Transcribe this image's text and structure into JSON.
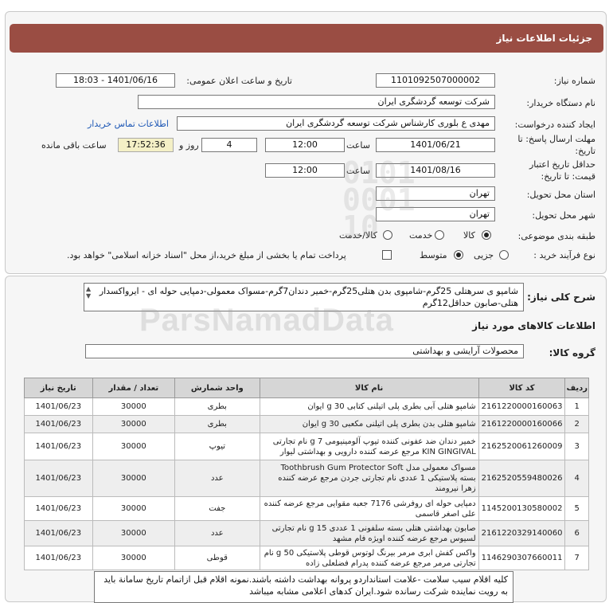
{
  "header": {
    "title": "جزئیات اطلاعات نیاز"
  },
  "form": {
    "need_number_label": "شماره نیاز:",
    "need_number": "1101092507000002",
    "announce_label": "تاریخ و ساعت اعلان عمومی:",
    "announce_value": "1401/06/16 - 18:03",
    "buyer_label": "نام دستگاه خریدار:",
    "buyer_value": "شرکت توسعه گردشگری ایران",
    "creator_label": "ایجاد کننده درخواست:",
    "creator_value": "مهدی ع بلوری کارشناس شرکت توسعه گردشگری ایران",
    "contact_link": "اطلاعات تماس خریدار",
    "deadline_label_1": "مهلت ارسال پاسخ: تا",
    "deadline_label_2": "تاریخ:",
    "deadline_date": "1401/06/21",
    "time_label": "ساعت",
    "deadline_time": "12:00",
    "days_value": "4",
    "days_label": "روز و",
    "remaining_time": "17:52:36",
    "remaining_label": "ساعت باقی مانده",
    "validity_label_1": "حداقل تاریخ اعتبار",
    "validity_label_2": "قیمت: تا تاریخ:",
    "validity_date": "1401/08/16",
    "validity_time": "12:00",
    "province_label": "استان محل تحویل:",
    "province_value": "تهران",
    "city_label": "شهر محل تحویل:",
    "city_value": "تهران",
    "category_label": "طبقه بندی موضوعی:",
    "category_options": [
      "کالا",
      "خدمت",
      "کالا/خدمت"
    ],
    "category_selected": "کالا",
    "process_label": "نوع فرآیند خرید :",
    "process_options": [
      "جزیی",
      "متوسط"
    ],
    "process_selected": "متوسط",
    "payment_text": "پرداخت تمام یا بخشی از مبلغ خرید،از محل \"اسناد خزانه اسلامی\" خواهد بود."
  },
  "description": {
    "label": "شرح کلی نیاز:",
    "text": "شامپو ی سرهتلی 25گرم-شامپوی بدن هتلی25گرم-خمیر دندان7گرم-مسواک معمولی-دمپایی حوله ای - ایرواکسدار هتلی-صابون حداقل12گرم"
  },
  "goods": {
    "section_title": "اطلاعات کالاهای مورد نیاز",
    "group_label": "گروه کالا:",
    "group_value": "محصولات آرایشی و بهداشتی",
    "columns": [
      "ردیف",
      "کد کالا",
      "نام کالا",
      "واحد شمارش",
      "تعداد / مقدار",
      "تاریخ نیاز"
    ],
    "rows": [
      {
        "row": "1",
        "code": "2161220000160063",
        "name": "شامپو هتلی آبی بطری پلی اتیلنی کتابی 30 g ایوان",
        "unit": "بطری",
        "qty": "30000",
        "date": "1401/06/23"
      },
      {
        "row": "2",
        "code": "2161220000160066",
        "name": "شامپو هتلی بدن بطری پلی اتیلنی مکعبی 30 g ایوان",
        "unit": "بطری",
        "qty": "30000",
        "date": "1401/06/23"
      },
      {
        "row": "3",
        "code": "2162520061260009",
        "name": "خمیر دندان ضد عفونی کننده تیوپ آلومینیومی 7 g نام تجارتی KIN GINGIVAL مرجع عرضه کننده دارویی و بهداشتی لیوار",
        "unit": "تیوپ",
        "qty": "30000",
        "date": "1401/06/23"
      },
      {
        "row": "4",
        "code": "2162520559480026",
        "name": "مسواک معمولی مدل Toothbrush Gum Protector Soft بسته پلاستیکی 1 عددی نام تجارتی جردن مرجع عرضه کننده زهرا نیرومند",
        "unit": "عدد",
        "qty": "30000",
        "date": "1401/06/23"
      },
      {
        "row": "5",
        "code": "1145200130580002",
        "name": "دمپایی حوله ای روفرشی 7176 جعبه مقوایی مرجع عرضه کننده علی اصغر قاسمی",
        "unit": "جفت",
        "qty": "30000",
        "date": "1401/06/23"
      },
      {
        "row": "6",
        "code": "2161220329140060",
        "name": "صابون بهداشتی هتلی بسته سلفونی 1 عددی 15 g نام تجارتی لسیوس مرجع عرضه کننده اویژه فام مشهد",
        "unit": "عدد",
        "qty": "30000",
        "date": "1401/06/23"
      },
      {
        "row": "7",
        "code": "1146290307660011",
        "name": "واکس کفش ابری مرمر بیرنگ لوتوس قوطی پلاستیکی 50 g نام تجارتی مرمر مرجع عرضه کننده پدرام فضلعلی زاده",
        "unit": "قوطی",
        "qty": "30000",
        "date": "1401/06/23"
      }
    ]
  },
  "notes": {
    "text": "کلیه اقلام سیب سلامت -علامت استانداردو پروانه بهداشت داشته باشند.نمونه اقلام قبل ازاتمام تاریخ سامانة باید به رویت نماینده شرکت رسانده شود.ایران کدهای اعلامی مشابه میباشد"
  },
  "watermark": {
    "brand": "ParsNamadData"
  },
  "colors": {
    "title_bar": "#9a4d43",
    "link": "#1d57b5",
    "timer_bg": "#f4f0c6"
  }
}
